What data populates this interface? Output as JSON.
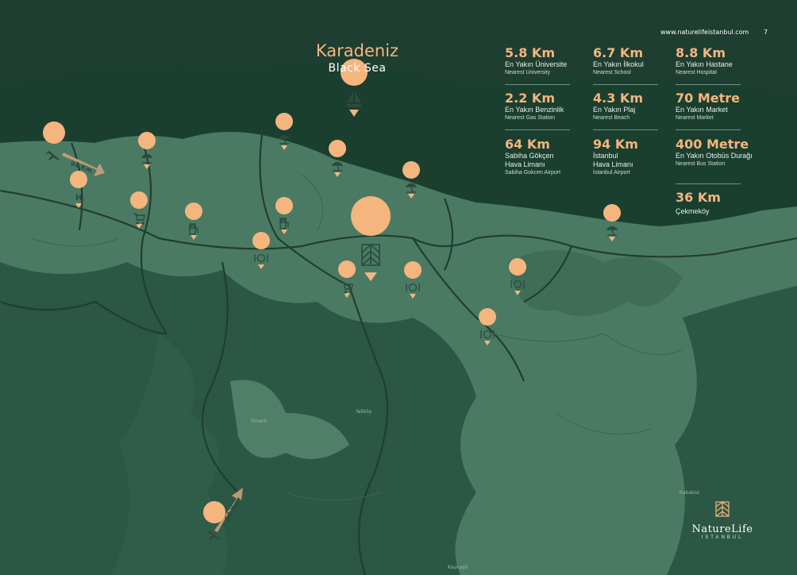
{
  "header": {
    "url": "www.naturelifeistanbul.com",
    "page_number": "7"
  },
  "sea": {
    "name_tr": "Karadeniz",
    "name_en": "Black Sea"
  },
  "distances": [
    {
      "value": "5.8 Km",
      "tr": "En Yakın Üniversite",
      "en": "Nearest University"
    },
    {
      "value": "6.7 Km",
      "tr": "En Yakın İlkokul",
      "en": "Nearest School"
    },
    {
      "value": "8.8 Km",
      "tr": "En Yakın Hastane",
      "en": "Nearest Hospital"
    },
    {
      "value": "2.2 Km",
      "tr": "En Yakın Benzinlik",
      "en": "Nearest Gas Station"
    },
    {
      "value": "4.3 Km",
      "tr": "En Yakın Plaj",
      "en": "Nearest Beach"
    },
    {
      "value": "70 Metre",
      "tr": "En Yakın Market",
      "en": "Nearest Market"
    },
    {
      "value": "64 Km",
      "tr": "Sabiha Gökçen",
      "tr2": "Hava Limanı",
      "en": "Sabiha Gokcen Airport"
    },
    {
      "value": "94 Km",
      "tr": "İstanbul",
      "tr2": "Hava Limanı",
      "en": "İstanbul Airport"
    },
    {
      "value": "400 Metre",
      "tr": "En Yakın Otobüs Durağı",
      "en": "Nearest Bus Station"
    },
    {
      "value": "36 Km",
      "tr": "Çekmeköy"
    }
  ],
  "route_labels": {
    "istanbul_airport": "94 Km",
    "sabiha_airport": "64 Km"
  },
  "map_labels": {
    "hospital": "H",
    "town1": "Ömerli",
    "town2": "Kaynaşlı",
    "town3": "Yalıköy",
    "town4": "Kabakoz"
  },
  "brand": {
    "name": "NatureLife",
    "sub": "ISTANBUL"
  },
  "colors": {
    "land": "#4a7a63",
    "forest": "#264f3c",
    "sea": "#1a3f2f",
    "accent": "#f4b57f",
    "road": "#223e31"
  },
  "markers": [
    {
      "name": "project-marker",
      "icon": "project-logo-icon"
    },
    {
      "name": "sailboat-marker",
      "icon": "sailboat-icon"
    },
    {
      "name": "airport-marker-istanbul",
      "icon": "plane-icon"
    },
    {
      "name": "airport-marker-sabiha",
      "icon": "plane-icon"
    },
    {
      "name": "hospital-marker",
      "icon": "hospital-icon"
    },
    {
      "name": "beach-marker",
      "icon": "beach-umbrella-icon"
    },
    {
      "name": "market-marker",
      "icon": "shopping-cart-icon"
    },
    {
      "name": "gas-station-marker",
      "icon": "fuel-pump-icon"
    },
    {
      "name": "restaurant-marker",
      "icon": "restaurant-icon"
    }
  ]
}
